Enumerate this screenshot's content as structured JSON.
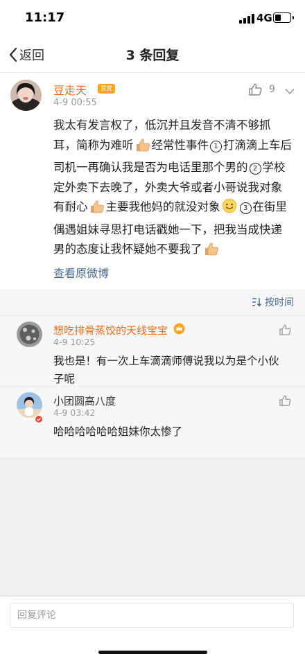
{
  "status_bar": {
    "time": "11:17",
    "network": "4G"
  },
  "nav": {
    "back_label": "返回",
    "title": "3 条回复"
  },
  "main_comment": {
    "user": "豆走天",
    "badge": "赞赏",
    "time": "4-9 00:55",
    "likes": "9",
    "text_parts": [
      "我太有发言权了，低沉并且发音不清不够抓耳，简称为难听",
      "经常性事件",
      "打滴滴上车后司机一再确认我是否为电话里那个男的",
      "学校定外卖下去晚了，外卖大爷或者小哥说我对象有耐心",
      "主要我他妈的就没对象",
      "在街里偶遇姐妹寻思打电话戳她一下，把我当成快递男的态度让我怀疑她不要我了"
    ],
    "nums": [
      "1",
      "2",
      "3"
    ],
    "view_original": "查看原微博"
  },
  "sort": {
    "label": "按时间"
  },
  "replies": [
    {
      "user": "想吃排骨蒸饺的天线宝宝",
      "time": "4-9 10:25",
      "text": "我也是！有一次上车滴滴师傅说我以为是个小伙子呢"
    },
    {
      "user": "小团圆高八度",
      "time": "4-9 03:42",
      "text": "哈哈哈哈哈哈姐妹你太惨了"
    }
  ],
  "reply_input": {
    "placeholder": "回复评论"
  },
  "icons": [
    "chevron-left-icon",
    "thumbs-up-icon",
    "more-icon",
    "sort-icon",
    "signal-icon",
    "battery-icon",
    "thumbs-up-emoji",
    "smile-emoji",
    "crown-badge-icon"
  ],
  "colors": {
    "username_orange": "#ea6e1d",
    "link_blue": "#4a6c93",
    "meta_gray": "#999999"
  }
}
